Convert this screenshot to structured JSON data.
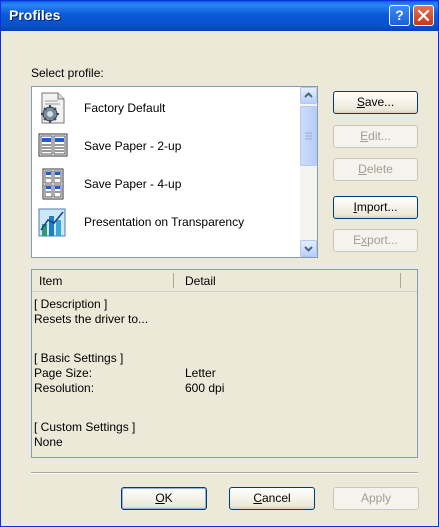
{
  "window": {
    "title": "Profiles"
  },
  "titlebar": {
    "help_glyph": "?",
    "help_icon": "help-icon",
    "close_icon": "close-icon"
  },
  "select_profile_label": "Select profile:",
  "profiles": [
    {
      "label": "Factory Default",
      "icon": "factory-default-icon",
      "selected": true
    },
    {
      "label": "Save Paper - 2-up",
      "icon": "two-up-icon",
      "selected": false
    },
    {
      "label": "Save Paper - 4-up",
      "icon": "four-up-icon",
      "selected": false
    },
    {
      "label": "Presentation on Transparency",
      "icon": "transparency-icon",
      "selected": false
    }
  ],
  "side_buttons": {
    "save": {
      "pre": "",
      "key": "S",
      "post": "ave...",
      "enabled": true
    },
    "edit": {
      "pre": "",
      "key": "E",
      "post": "dit...",
      "enabled": false
    },
    "delete": {
      "pre": "",
      "key": "D",
      "post": "elete",
      "enabled": false
    },
    "import": {
      "pre": "",
      "key": "I",
      "post": "mport...",
      "enabled": true
    },
    "export": {
      "pre": "E",
      "key": "x",
      "post": "port...",
      "enabled": false
    }
  },
  "details": {
    "headers": {
      "item": "Item",
      "detail": "Detail"
    },
    "description_heading": "[ Description ]",
    "description_text": "Resets the driver to...",
    "basic_heading": "[ Basic Settings ]",
    "rows": [
      {
        "item": "Page Size:",
        "detail": "Letter"
      },
      {
        "item": "Resolution:",
        "detail": "600 dpi"
      }
    ],
    "custom_heading": "[ Custom Settings ]",
    "custom_value": "None"
  },
  "footer_buttons": {
    "ok": {
      "key": "O",
      "post": "K",
      "enabled": true
    },
    "cancel": {
      "key": "C",
      "post": "ancel",
      "enabled": true
    },
    "apply": {
      "label": "Apply",
      "enabled": false
    }
  },
  "colors": {
    "titlebar": "#0a5ad8",
    "dialog_bg": "#ece9d8",
    "border_blue": "#7f9db9",
    "disabled_text": "#a19d8f"
  }
}
